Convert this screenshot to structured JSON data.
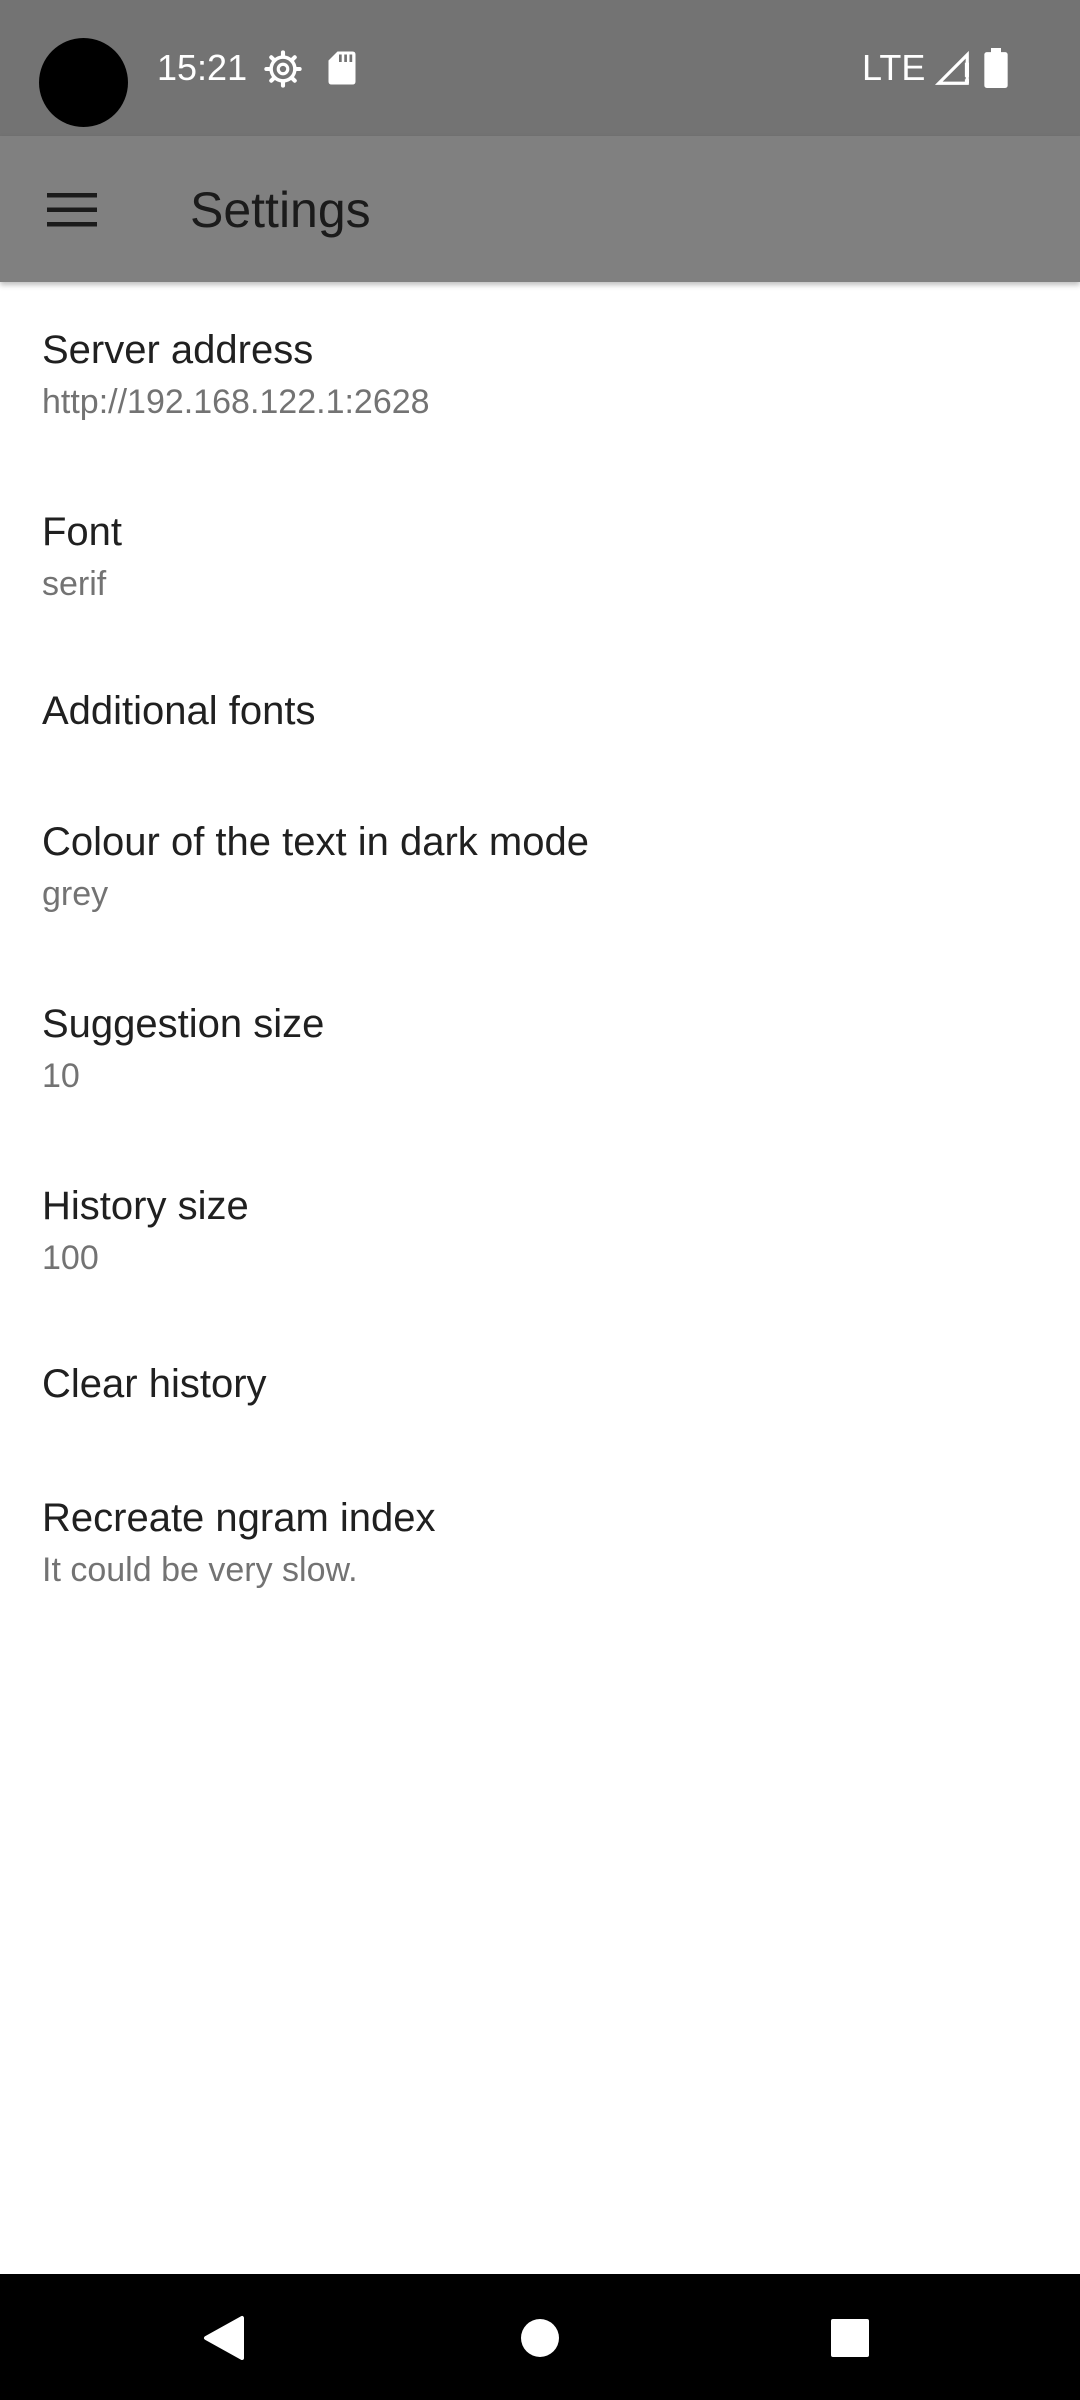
{
  "status_bar": {
    "time": "15:21",
    "network": "LTE",
    "icons": [
      "gear-icon",
      "sd-card-icon",
      "signal-icon",
      "battery-icon"
    ]
  },
  "app_bar": {
    "title": "Settings",
    "menu_icon": "hamburger-menu-icon"
  },
  "preferences": [
    {
      "title": "Server address",
      "summary": "http://192.168.122.1:2628"
    },
    {
      "title": "Font",
      "summary": "serif"
    },
    {
      "title": "Additional fonts",
      "summary": ""
    },
    {
      "title": "Colour of the text in dark mode",
      "summary": "grey"
    },
    {
      "title": "Suggestion size",
      "summary": "10"
    },
    {
      "title": "History size",
      "summary": "100"
    },
    {
      "title": "Clear history",
      "summary": ""
    },
    {
      "title": "Recreate ngram index",
      "summary": "It could be very slow."
    }
  ],
  "nav_bar": {
    "buttons": [
      "back-icon",
      "home-icon",
      "recents-icon"
    ]
  },
  "colors": {
    "status_bar": "#737373",
    "app_bar": "#808080",
    "title_text": "#202020",
    "summary_text": "#737373"
  }
}
